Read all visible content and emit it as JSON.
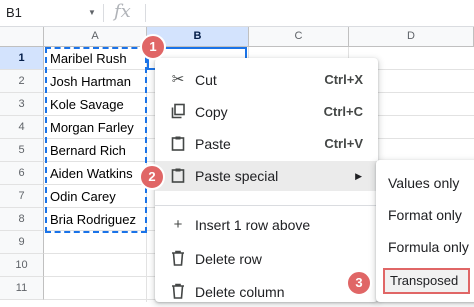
{
  "formula_bar": {
    "name_box": "B1",
    "fx_label": "fx",
    "formula": ""
  },
  "columns": [
    "A",
    "B",
    "C",
    "D"
  ],
  "rows": [
    "1",
    "2",
    "3",
    "4",
    "5",
    "6",
    "7",
    "8",
    "9",
    "10",
    "11"
  ],
  "cells_a": [
    "Maribel Rush",
    "Josh Hartman",
    "Kole Savage",
    "Morgan Farley",
    "Bernard Rich",
    "Aiden Watkins",
    "Odin Carey",
    "Bria Rodriguez"
  ],
  "context_menu": {
    "items": [
      {
        "icon": "scissors-icon",
        "label": "Cut",
        "shortcut": "Ctrl+X"
      },
      {
        "icon": "copy-icon",
        "label": "Copy",
        "shortcut": "Ctrl+C"
      },
      {
        "icon": "clipboard-icon",
        "label": "Paste",
        "shortcut": "Ctrl+V"
      },
      {
        "icon": "clipboard-icon",
        "label": "Paste special",
        "shortcut": ""
      },
      {
        "icon": "plus-icon",
        "label": "Insert 1 row above",
        "shortcut": ""
      },
      {
        "icon": "trash-icon",
        "label": "Delete row",
        "shortcut": ""
      },
      {
        "icon": "trash-icon",
        "label": "Delete column",
        "shortcut": ""
      }
    ],
    "submenu_arrow": "▶"
  },
  "paste_special_menu": {
    "items": [
      "Values only",
      "Format only",
      "Formula only",
      "Transposed"
    ]
  },
  "badges": [
    "1",
    "2",
    "3"
  ],
  "colors": {
    "selection": "#1a73e8",
    "badge": "#e06666",
    "highlight": "#ebebeb"
  }
}
